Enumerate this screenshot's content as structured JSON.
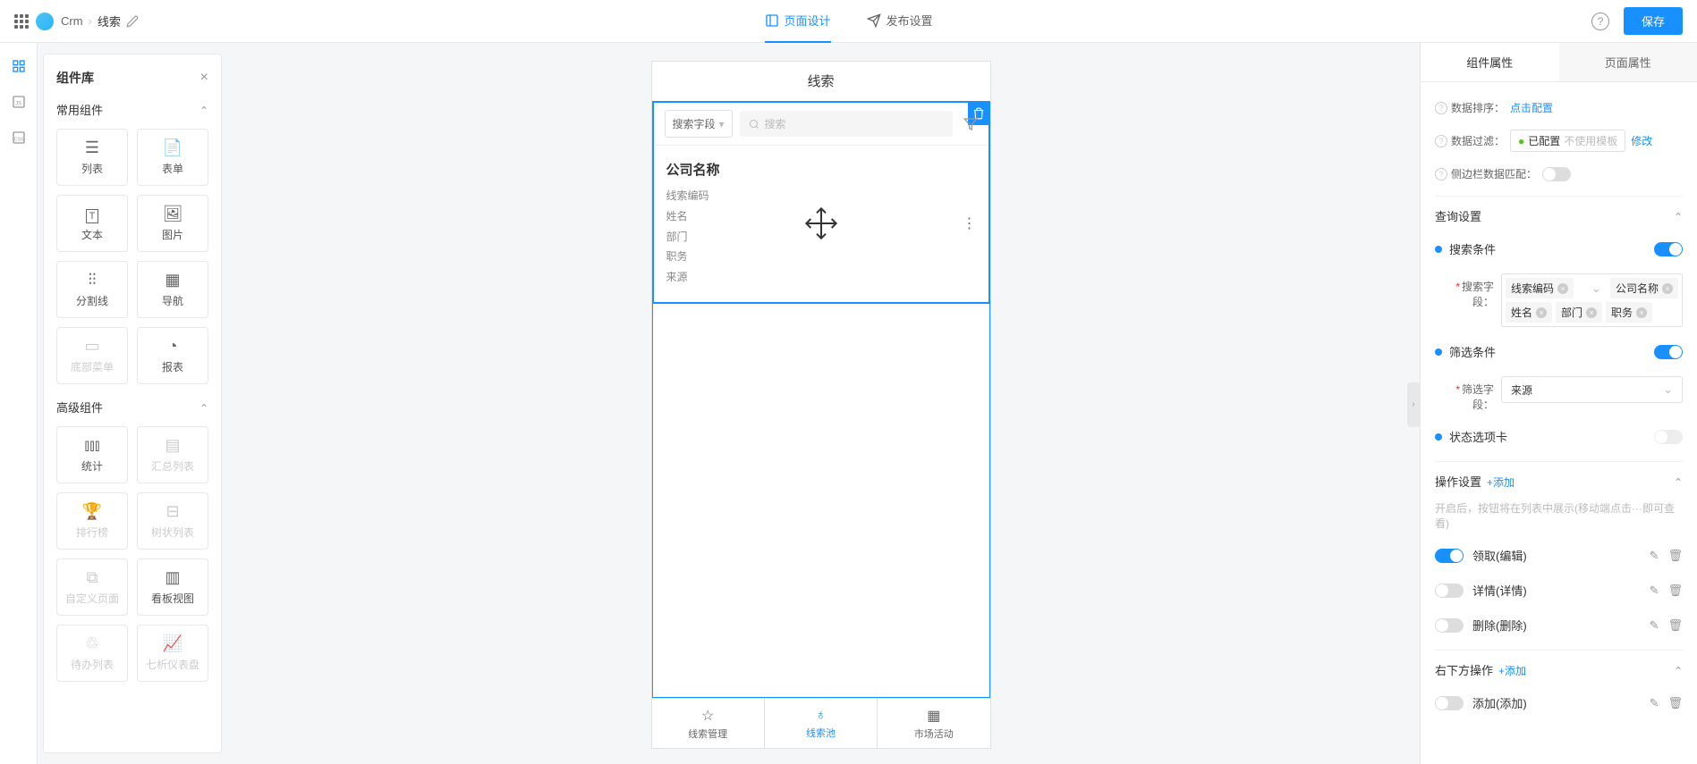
{
  "breadcrumb": {
    "app": "Crm",
    "current": "线索"
  },
  "top_tabs": {
    "design": "页面设计",
    "publish": "发布设置"
  },
  "header_actions": {
    "save": "保存"
  },
  "comp_panel": {
    "title": "组件库",
    "sections": {
      "common": {
        "title": "常用组件",
        "items": [
          "列表",
          "表单",
          "文本",
          "图片",
          "分割线",
          "导航",
          "底部菜单",
          "报表"
        ]
      },
      "advanced": {
        "title": "高级组件",
        "items": [
          "统计",
          "汇总列表",
          "排行榜",
          "树状列表",
          "自定义页面",
          "看板视图",
          "待办列表",
          "七析仪表盘"
        ]
      }
    }
  },
  "canvas": {
    "page_title": "线索",
    "search_field_label": "搜索字段",
    "search_placeholder": "搜索",
    "card": {
      "title": "公司名称",
      "fields": [
        "线索编码",
        "姓名",
        "部门",
        "职务",
        "来源"
      ]
    },
    "tabs": [
      "线索管理",
      "线索池",
      "市场活动"
    ]
  },
  "props": {
    "tabs": {
      "component": "组件属性",
      "page": "页面属性"
    },
    "data_sort": {
      "label": "数据排序：",
      "action": "点击配置"
    },
    "data_filter": {
      "label": "数据过滤：",
      "status": "已配置",
      "template": "不使用模板",
      "modify": "修改"
    },
    "side_match": {
      "label": "侧边栏数据匹配："
    },
    "query_section": "查询设置",
    "search_cond": {
      "label": "搜索条件",
      "field_label": "搜索字段：",
      "tags": [
        "线索编码",
        "公司名称",
        "姓名",
        "部门",
        "职务"
      ]
    },
    "filter_cond": {
      "label": "筛选条件",
      "field_label": "筛选字段：",
      "value": "来源"
    },
    "status_tab": {
      "label": "状态选项卡"
    },
    "ops_section": {
      "title": "操作设置",
      "add": "+添加",
      "hint": "开启后，按钮将在列表中展示(移动端点击···即可查看)"
    },
    "ops": [
      {
        "label": "领取(编辑)",
        "on": true
      },
      {
        "label": "详情(详情)",
        "on": false
      },
      {
        "label": "删除(删除)",
        "on": false
      }
    ],
    "bottom_section": {
      "title": "右下方操作",
      "add": "+添加"
    },
    "bottom_ops": [
      {
        "label": "添加(添加)",
        "on": false
      }
    ]
  }
}
